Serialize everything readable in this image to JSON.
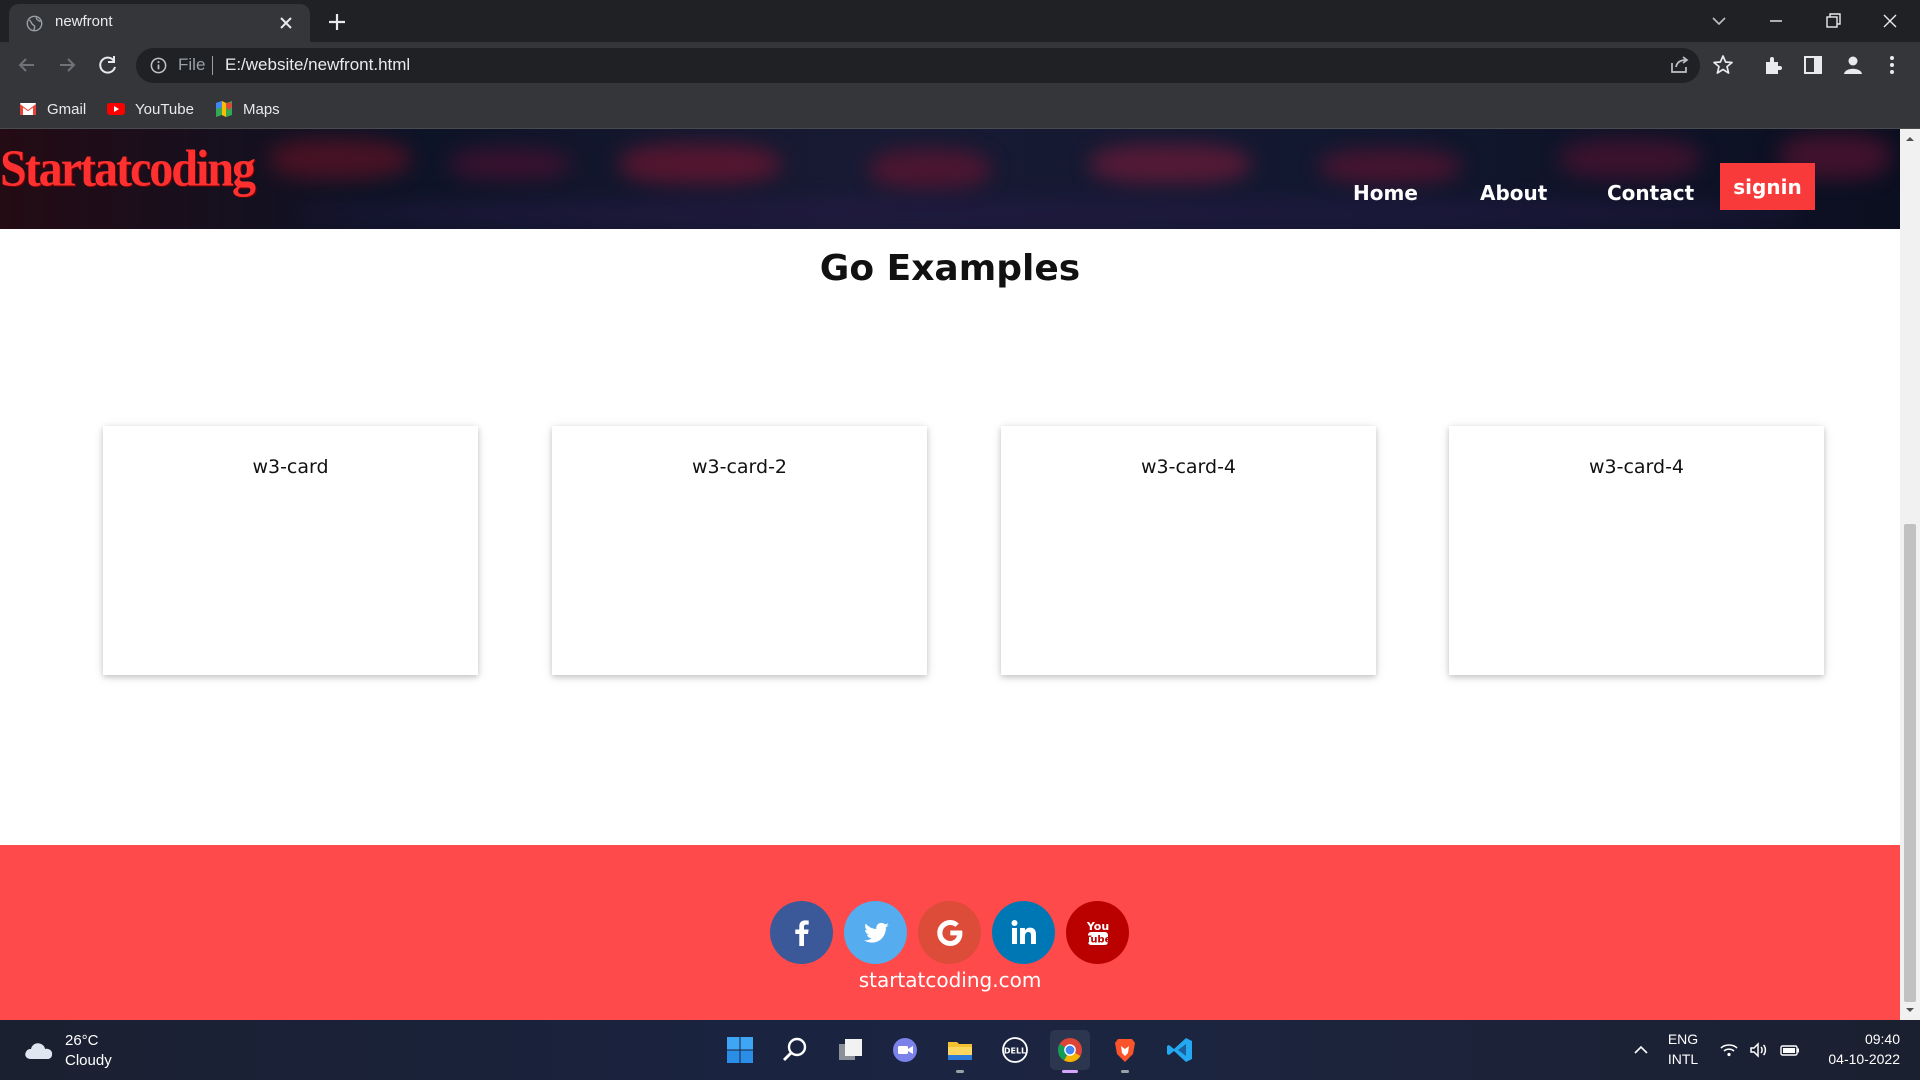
{
  "browser": {
    "tab_title": "newfront",
    "omnibox_scheme": "File",
    "omnibox_url": "E:/website/newfront.html",
    "bookmarks": [
      {
        "label": "Gmail",
        "icon": "gmail-icon"
      },
      {
        "label": "YouTube",
        "icon": "youtube-icon"
      },
      {
        "label": "Maps",
        "icon": "maps-icon"
      }
    ]
  },
  "site": {
    "brand": "Startatcoding",
    "nav": [
      "Home",
      "About",
      "Contact"
    ],
    "signin": "signin",
    "section_title": "Go Examples",
    "cards": [
      "w3-card",
      "w3-card-2",
      "w3-card-4",
      "w3-card-4"
    ],
    "social": [
      {
        "name": "facebook",
        "icon": "facebook-icon",
        "color": "#3b5998"
      },
      {
        "name": "twitter",
        "icon": "twitter-icon",
        "color": "#55acee"
      },
      {
        "name": "google",
        "icon": "google-icon",
        "color": "#dd4b39"
      },
      {
        "name": "linkedin",
        "icon": "linkedin-icon",
        "color": "#0077b5"
      },
      {
        "name": "youtube",
        "icon": "youtube-icon",
        "color": "#bb0000"
      }
    ],
    "footer_text": "startatcoding.com",
    "colors": {
      "brand": "#ff3030",
      "accent": "#f83a3a",
      "footer": "#fe4a4a"
    }
  },
  "taskbar": {
    "weather_temp": "26°C",
    "weather_desc": "Cloudy",
    "lang_1": "ENG",
    "lang_2": "INTL",
    "time": "09:40",
    "date": "04-10-2022"
  }
}
